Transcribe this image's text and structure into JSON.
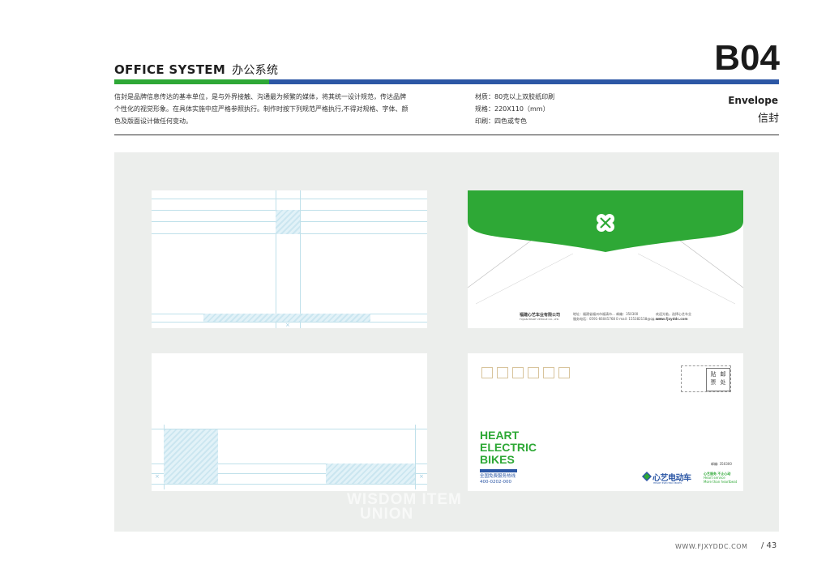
{
  "header": {
    "section_en": "OFFICE SYSTEM",
    "section_cn": "办公系统",
    "code": "B04",
    "title_en": "Envelope",
    "title_cn": "信封"
  },
  "description": [
    "信封是品牌信息传达的基本单位，是与外界接触、沟通最为频繁的媒体，将其统一设计规范，传达品牌",
    "个性化的视觉形象。在具体实施中应严格参照执行。制作时按下列规范严格执行,不得对规格、字体、颜",
    "色及版面设计做任何变动。"
  ],
  "specs": [
    "材质：80克以上双胶纸印刷",
    "规格：220X110（mm）",
    "印刷：四色或专色"
  ],
  "envelope_back": {
    "company_cn": "福建心艺车业有限公司",
    "company_en": "FUJIAN HEART VEHICLE CO., LTD.",
    "address": "地址：福建省福州市福清市... 邮编：350300",
    "phone": "服务电话：0591-66045768  E-mail: 155382158@qq.com",
    "slogan": "欢迎光临，选择心艺车业",
    "website": "www.fjxyddc.com"
  },
  "envelope_front": {
    "stamp_label": "贴邮票处",
    "stamp_col1": "贴",
    "stamp_col1b": "票",
    "stamp_col2": "邮",
    "stamp_col2b": "处",
    "brand_lines": [
      "HEART",
      "ELECTRIC",
      "BIKES"
    ],
    "hotline_label": "全国免费服务热线",
    "hotline_number": "400-0202-000",
    "zip_label": "邮编: 350300",
    "logo_cn": "心艺电动车",
    "logo_en": "HEART ELECTRIC BIKES",
    "slogan_cn": "心艺服务 不止心动",
    "slogan_en1": "Heart service",
    "slogan_en2": "More than heartbeat"
  },
  "watermark": {
    "line1": "WISDOM ITEM",
    "line2": "UNION"
  },
  "footer": {
    "url": "WWW.FJXYDDC.COM",
    "page": "/ 43"
  },
  "colors": {
    "brand_green": "#2ea836",
    "brand_blue": "#2c57a5",
    "stage_bg": "#eceeec"
  }
}
